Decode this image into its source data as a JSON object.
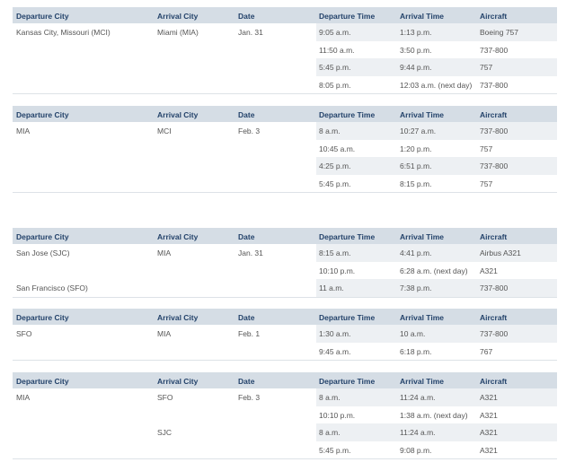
{
  "headers": {
    "departure_city": "Departure City",
    "arrival_city": "Arrival City",
    "date": "Date",
    "departure_time": "Departure Time",
    "arrival_time": "Arrival Time",
    "aircraft": "Aircraft"
  },
  "schedules": [
    {
      "rows": [
        {
          "departure_city": "Kansas City, Missouri (MCI)",
          "arrival_city": "Miami (MIA)",
          "date": "Jan. 31",
          "departure_time": "9:05 a.m.",
          "arrival_time": "1:13 p.m.",
          "aircraft": "Boeing 757"
        },
        {
          "departure_city": "",
          "arrival_city": "",
          "date": "",
          "departure_time": "11:50 a.m.",
          "arrival_time": "3:50 p.m.",
          "aircraft": "737-800"
        },
        {
          "departure_city": "",
          "arrival_city": "",
          "date": "",
          "departure_time": "5:45 p.m.",
          "arrival_time": "9:44 p.m.",
          "aircraft": "757"
        },
        {
          "departure_city": "",
          "arrival_city": "",
          "date": "",
          "departure_time": "8:05 p.m.",
          "arrival_time": "12:03 a.m. (next day)",
          "aircraft": "737-800"
        }
      ]
    },
    {
      "rows": [
        {
          "departure_city": "MIA",
          "arrival_city": "MCI",
          "date": "Feb. 3",
          "departure_time": "8 a.m.",
          "arrival_time": "10:27 a.m.",
          "aircraft": "737-800"
        },
        {
          "departure_city": "",
          "arrival_city": "",
          "date": "",
          "departure_time": "10:45 a.m.",
          "arrival_time": "1:20 p.m.",
          "aircraft": "757"
        },
        {
          "departure_city": "",
          "arrival_city": "",
          "date": "",
          "departure_time": "4:25 p.m.",
          "arrival_time": "6:51 p.m.",
          "aircraft": "737-800"
        },
        {
          "departure_city": "",
          "arrival_city": "",
          "date": "",
          "departure_time": "5:45 p.m.",
          "arrival_time": "8:15 p.m.",
          "aircraft": "757"
        }
      ]
    },
    {
      "rows": [
        {
          "departure_city": "San Jose (SJC)",
          "arrival_city": "MIA",
          "date": "Jan. 31",
          "departure_time": "8:15 a.m.",
          "arrival_time": "4:41 p.m.",
          "aircraft": "Airbus A321"
        },
        {
          "departure_city": "",
          "arrival_city": "",
          "date": "",
          "departure_time": "10:10 p.m.",
          "arrival_time": "6:28 a.m. (next day)",
          "aircraft": "A321"
        },
        {
          "departure_city": "San Francisco (SFO)",
          "arrival_city": "",
          "date": "",
          "departure_time": "11 a.m.",
          "arrival_time": "7:38 p.m.",
          "aircraft": "737-800"
        }
      ]
    },
    {
      "rows": [
        {
          "departure_city": "SFO",
          "arrival_city": "MIA",
          "date": "Feb. 1",
          "departure_time": "1:30 a.m.",
          "arrival_time": "10 a.m.",
          "aircraft": "737-800"
        },
        {
          "departure_city": "",
          "arrival_city": "",
          "date": "",
          "departure_time": "9:45 a.m.",
          "arrival_time": "6:18 p.m.",
          "aircraft": "767"
        }
      ]
    },
    {
      "rows": [
        {
          "departure_city": "MIA",
          "arrival_city": "SFO",
          "date": "Feb. 3",
          "departure_time": "8 a.m.",
          "arrival_time": "11:24 a.m.",
          "aircraft": "A321"
        },
        {
          "departure_city": "",
          "arrival_city": "",
          "date": "",
          "departure_time": "10:10 p.m.",
          "arrival_time": "1:38 a.m. (next day)",
          "aircraft": "A321"
        },
        {
          "departure_city": "",
          "arrival_city": "SJC",
          "date": "",
          "departure_time": "8 a.m.",
          "arrival_time": "11:24 a.m.",
          "aircraft": "A321"
        },
        {
          "departure_city": "",
          "arrival_city": "",
          "date": "",
          "departure_time": "5:45 p.m.",
          "arrival_time": "9:08 p.m.",
          "aircraft": "A321"
        }
      ]
    }
  ]
}
